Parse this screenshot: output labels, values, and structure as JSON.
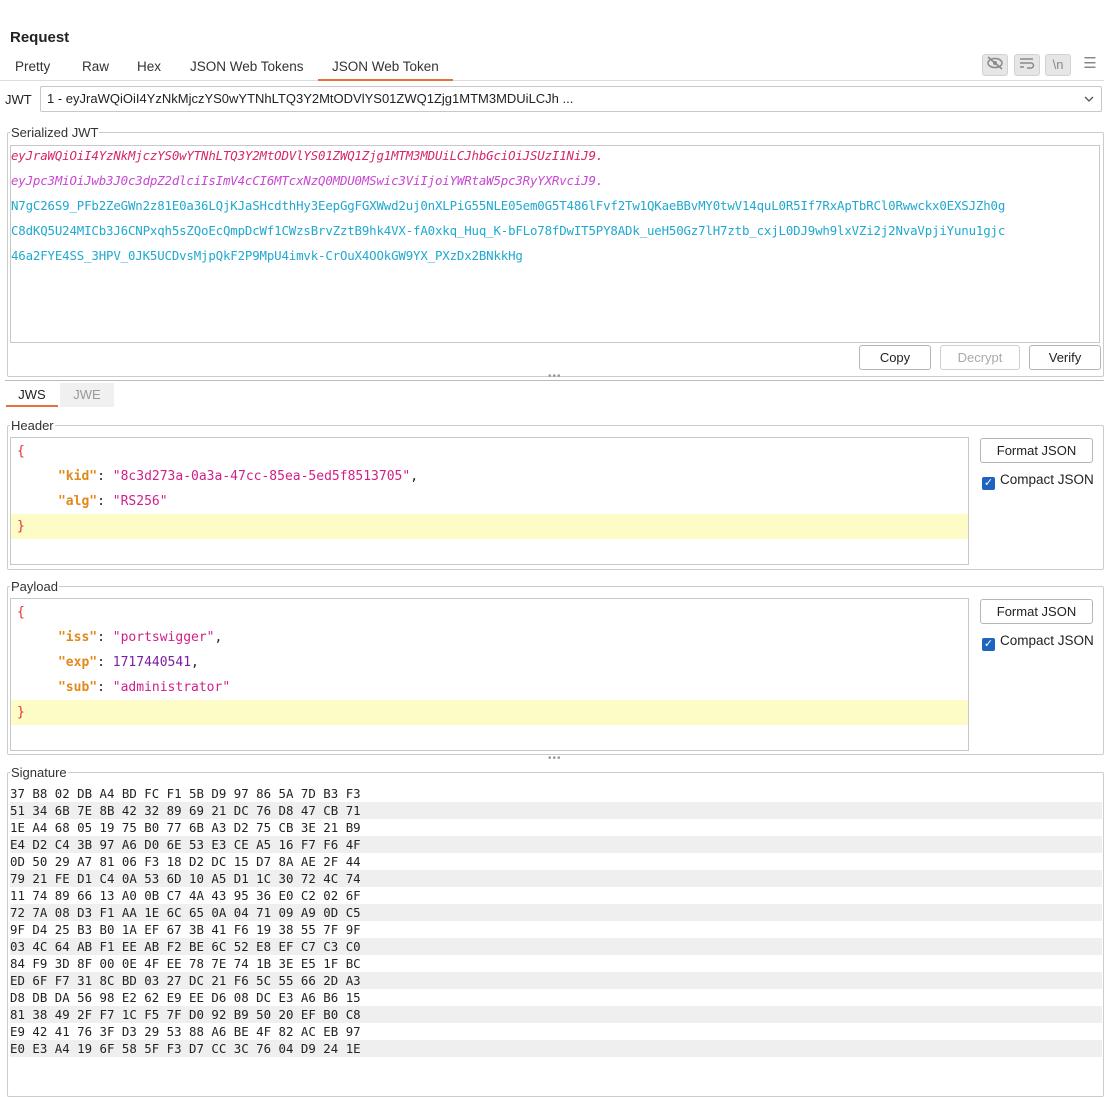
{
  "title": "Request",
  "tabs": [
    "Pretty",
    "Raw",
    "Hex",
    "JSON Web Tokens",
    "JSON Web Token"
  ],
  "jwt_selector": {
    "label": "JWT",
    "value": "1 - eyJraWQiOiI4YzNkMjczYS0wYTNhLTQ3Y2MtODVlYS01ZWQ1Zjg1MTM3MDUiLCJh ..."
  },
  "serialized": {
    "legend": "Serialized JWT",
    "header": "eyJraWQiOiI4YzNkMjczYS0wYTNhLTQ3Y2MtODVlYS01ZWQ1Zjg1MTM3MDUiLCJhbGciOiJSUzI1NiJ9.",
    "payload": "eyJpc3MiOiJwb3J0c3dpZ2dlciIsImV4cCI6MTcxNzQ0MDU0MSwic3ViIjoiYWRtaW5pc3RyYXRvciJ9.",
    "signature_lines": [
      "N7gC26S9_PFb2ZeGWn2z81E0a36LQjKJaSHcdthHy3EepGgFGXWwd2uj0nXLPiG55NLE05em0G5T486lFvf2Tw1QKaeBBvMY0twV14quL0R5If7RxApTbRCl0Rwwckx0EXSJZh0g",
      "C8dKQ5U24MICb3J6CNPxqh5sZQoEcQmpDcWf1CWzsBrvZztB9hk4VX-fA0xkq_Huq_K-bFLo78fDwIT5PY8ADk_ueH50Gz7lH7ztb_cxjL0DJ9wh9lxVZi2j2NvaVpjiYunu1gjc",
      "46a2FYE4SS_3HPV_0JK5UCDvsMjpQkF2P9MpU4imvk-CrOuX4OOkGW9YX_PXzDx2BNkkHg"
    ],
    "buttons": {
      "copy": "Copy",
      "decrypt": "Decrypt",
      "verify": "Verify"
    }
  },
  "subtabs": [
    "JWS",
    "JWE"
  ],
  "header_section": {
    "legend": "Header",
    "open": "{",
    "close": "}",
    "kid_key": "\"kid\"",
    "kid_value": "\"8c3d273a-0a3a-47cc-85ea-5ed5f8513705\"",
    "alg_key": "\"alg\"",
    "alg_value": "\"RS256\"",
    "format_button": "Format JSON",
    "compact_label": "Compact JSON"
  },
  "payload_section": {
    "legend": "Payload",
    "open": "{",
    "close": "}",
    "iss_key": "\"iss\"",
    "iss_value": "\"portswigger\"",
    "exp_key": "\"exp\"",
    "exp_value": "1717440541",
    "sub_key": "\"sub\"",
    "sub_value": "\"administrator\"",
    "format_button": "Format JSON",
    "compact_label": "Compact JSON"
  },
  "signature_section": {
    "legend": "Signature",
    "rows": [
      "37 B8 02 DB A4 BD FC F1 5B D9 97 86 5A 7D B3 F3",
      "51 34 6B 7E 8B 42 32 89 69 21 DC 76 D8 47 CB 71",
      "1E A4 68 05 19 75 B0 77 6B A3 D2 75 CB 3E 21 B9",
      "E4 D2 C4 3B 97 A6 D0 6E 53 E3 CE A5 16 F7 F6 4F",
      "0D 50 29 A7 81 06 F3 18 D2 DC 15 D7 8A AE 2F 44",
      "79 21 FE D1 C4 0A 53 6D 10 A5 D1 1C 30 72 4C 74",
      "11 74 89 66 13 A0 0B C7 4A 43 95 36 E0 C2 02 6F",
      "72 7A 08 D3 F1 AA 1E 6C 65 0A 04 71 09 A9 0D C5",
      "9F D4 25 B3 B0 1A EF 67 3B 41 F6 19 38 55 7F 9F",
      "03 4C 64 AB F1 EE AB F2 BE 6C 52 E8 EF C7 C3 C0",
      "84 F9 3D 8F 00 0E 4F EE 78 7E 74 1B 3E E5 1F BC",
      "ED 6F F7 31 8C BD 03 27 DC 21 F6 5C 55 66 2D A3",
      "D8 DB DA 56 98 E2 62 E9 EE D6 08 DC E3 A6 B6 15",
      "81 38 49 2F F7 1C F5 7F D0 92 B9 50 20 EF B0 C8",
      "E9 42 41 76 3F D3 29 53 88 A6 BE 4F 82 AC EB 97",
      "E0 E3 A4 19 6F 58 5F F3 D7 CC 3C 76 04 D9 24 1E"
    ]
  },
  "toolbar_icons": [
    "eye-off-icon",
    "wrap-icon",
    "newline-icon",
    "menu-icon"
  ]
}
